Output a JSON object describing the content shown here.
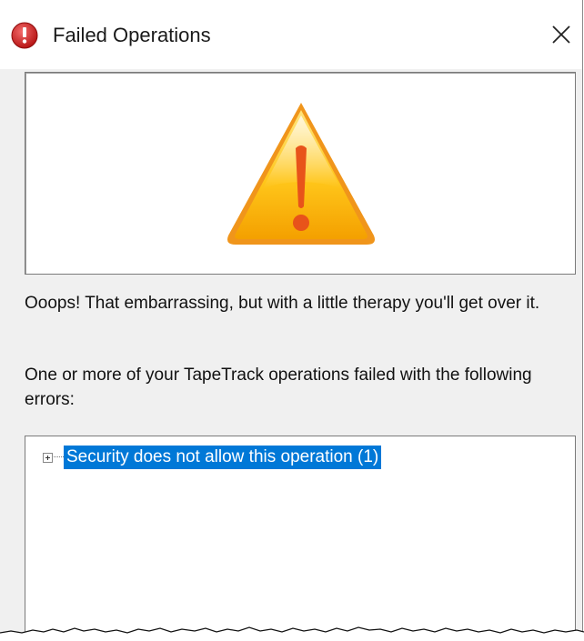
{
  "window": {
    "title": "Failed Operations",
    "title_icon": "error-icon",
    "close_icon": "close-icon",
    "close_glyph": "✕"
  },
  "banner": {
    "icon": "warning-icon",
    "colors": {
      "triangle": "#f7b500",
      "mark": "#e8531a"
    }
  },
  "messages": {
    "line1": "Ooops! That embarrassing, but with a little therapy you'll get over it.",
    "line2": "One or more of your TapeTrack operations failed with the following errors:"
  },
  "error_tree": {
    "items": [
      {
        "label": "Security does not allow this operation (1)",
        "expanded": false,
        "selected": true
      }
    ]
  },
  "colors": {
    "selection": "#0078d7",
    "error_red": "#d42020"
  }
}
